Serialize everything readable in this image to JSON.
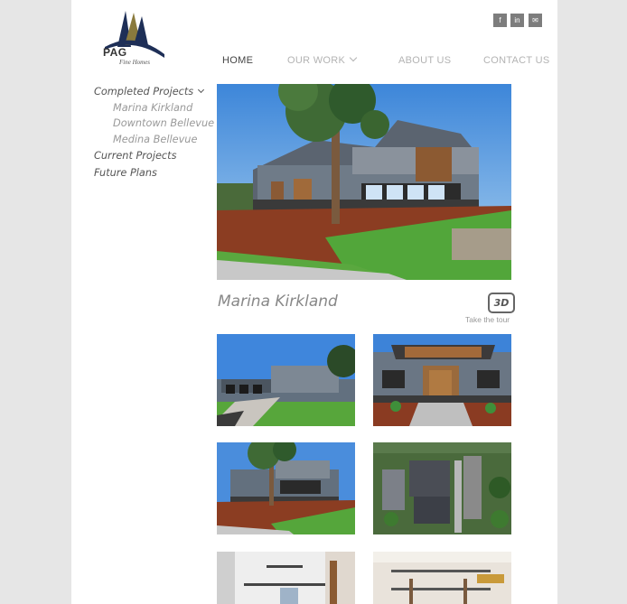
{
  "brand": {
    "name": "PAG",
    "tagline": "Fine Homes"
  },
  "social": [
    {
      "label": "f",
      "icon": "facebook-icon"
    },
    {
      "label": "in",
      "icon": "linkedin-icon"
    },
    {
      "label": "✉",
      "icon": "email-icon"
    }
  ],
  "nav": {
    "home": "HOME",
    "our_work": "OUR WORK",
    "about": "ABOUT US",
    "contact": "CONTACT US"
  },
  "sidebar": {
    "completed": "Completed Projects",
    "completed_items": [
      "Marina Kirkland",
      "Downtown Bellevue",
      "Medina Bellevue"
    ],
    "current": "Current Projects",
    "future": "Future Plans"
  },
  "project": {
    "title": "Marina Kirkland",
    "badge": "3D",
    "tour_label": "Take the tour"
  },
  "colors": {
    "background": "#e6e6e6",
    "page": "#ffffff",
    "nav_active": "#444444",
    "nav_inactive": "#b3b3b3",
    "social": "#7d7d7d"
  }
}
